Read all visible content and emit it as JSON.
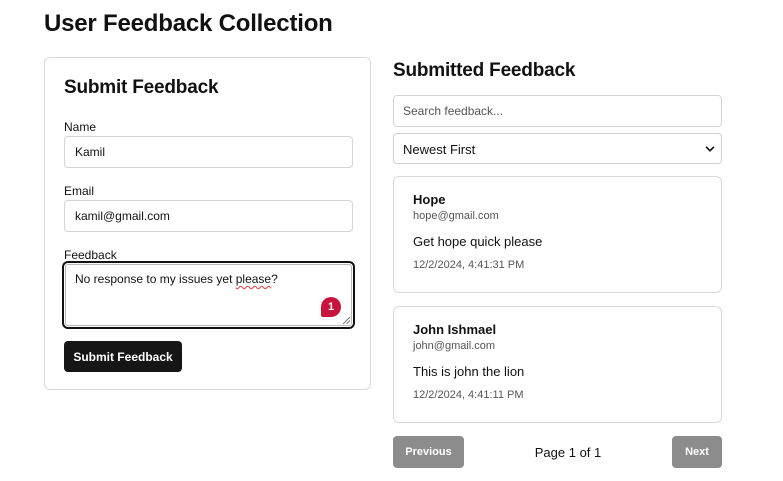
{
  "page": {
    "title": "User Feedback Collection"
  },
  "form": {
    "heading": "Submit Feedback",
    "name_label": "Name",
    "name_value": "Kamil",
    "email_label": "Email",
    "email_value": "kamil@gmail.com",
    "feedback_label": "Feedback",
    "feedback_text_before": "No response to my issues yet ",
    "feedback_text_flagged": "please",
    "feedback_text_after": "?",
    "grammar_issue_count": "1",
    "submit_label": "Submit Feedback"
  },
  "list": {
    "heading": "Submitted Feedback",
    "search_placeholder": "Search feedback...",
    "sort_value": "Newest First",
    "items": [
      {
        "name": "Hope",
        "email": "hope@gmail.com",
        "message": "Get hope quick please",
        "date": "12/2/2024, 4:41:31 PM"
      },
      {
        "name": "John Ishmael",
        "email": "john@gmail.com",
        "message": "This is john the lion",
        "date": "12/2/2024, 4:41:11 PM"
      }
    ]
  },
  "pagination": {
    "previous_label": "Previous",
    "page_text": "Page 1 of 1",
    "next_label": "Next"
  },
  "colors": {
    "primary_button": "#161616",
    "disabled_button": "#8c8c8c",
    "grammar_badge": "#c8143c"
  },
  "icons": {
    "sort": "chevron-down-icon",
    "grammar": "grammar-badge-icon",
    "resize": "resize-grip-icon"
  }
}
